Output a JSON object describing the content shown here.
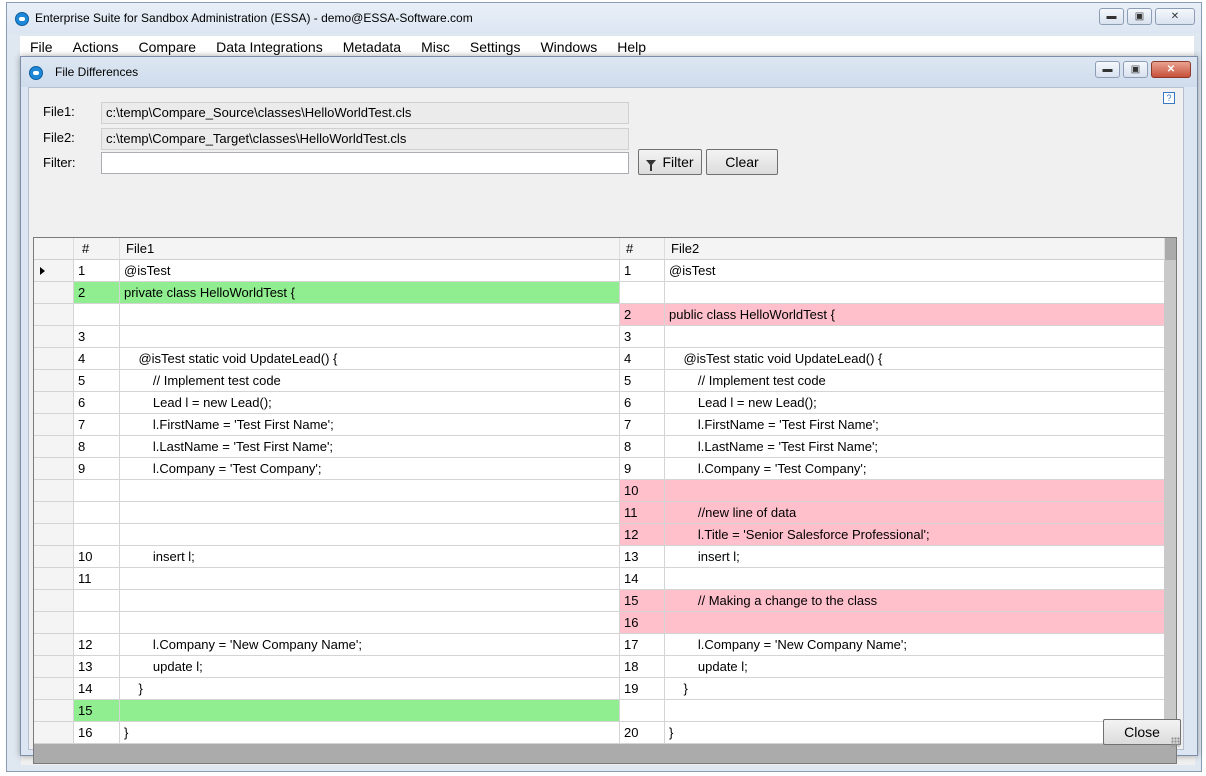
{
  "main_window": {
    "title": "Enterprise Suite for Sandbox Administration (ESSA) - demo@ESSA-Software.com",
    "menu": [
      "File",
      "Actions",
      "Compare",
      "Data Integrations",
      "Metadata",
      "Misc",
      "Settings",
      "Windows",
      "Help"
    ]
  },
  "dialog": {
    "title": "File Differences",
    "help_icon_label": "?",
    "file1_label": "File1:",
    "file1_value": "c:\\temp\\Compare_Source\\classes\\HelloWorldTest.cls",
    "file2_label": "File2:",
    "file2_value": "c:\\temp\\Compare_Target\\classes\\HelloWorldTest.cls",
    "filter_label": "Filter:",
    "filter_value": "",
    "filter_button": "Filter",
    "clear_button": "Clear",
    "close_button": "Close"
  },
  "grid": {
    "headers": {
      "num1": "#",
      "file1": "File1",
      "num2": "#",
      "file2": "File2"
    },
    "rows": [
      {
        "n1": "1",
        "t1": "@isTest",
        "n2": "1",
        "t2": "@isTest",
        "s1": "",
        "s2": "",
        "current": true
      },
      {
        "n1": "2",
        "t1": "private class HelloWorldTest {",
        "n2": "",
        "t2": "",
        "s1": "green",
        "s2": ""
      },
      {
        "n1": "",
        "t1": "",
        "n2": "2",
        "t2": "public class HelloWorldTest {",
        "s1": "",
        "s2": "pink"
      },
      {
        "n1": "3",
        "t1": "",
        "n2": "3",
        "t2": "",
        "s1": "",
        "s2": ""
      },
      {
        "n1": "4",
        "t1": "    @isTest static void UpdateLead() {",
        "n2": "4",
        "t2": "    @isTest static void UpdateLead() {",
        "s1": "",
        "s2": ""
      },
      {
        "n1": "5",
        "t1": "        // Implement test code",
        "n2": "5",
        "t2": "        // Implement test code",
        "s1": "",
        "s2": ""
      },
      {
        "n1": "6",
        "t1": "        Lead l = new Lead();",
        "n2": "6",
        "t2": "        Lead l = new Lead();",
        "s1": "",
        "s2": ""
      },
      {
        "n1": "7",
        "t1": "        l.FirstName = 'Test First Name';",
        "n2": "7",
        "t2": "        l.FirstName = 'Test First Name';",
        "s1": "",
        "s2": ""
      },
      {
        "n1": "8",
        "t1": "        l.LastName = 'Test First Name';",
        "n2": "8",
        "t2": "        l.LastName = 'Test First Name';",
        "s1": "",
        "s2": ""
      },
      {
        "n1": "9",
        "t1": "        l.Company = 'Test Company';",
        "n2": "9",
        "t2": "        l.Company = 'Test Company';",
        "s1": "",
        "s2": ""
      },
      {
        "n1": "",
        "t1": "",
        "n2": "10",
        "t2": "",
        "s1": "",
        "s2": "pink"
      },
      {
        "n1": "",
        "t1": "",
        "n2": "11",
        "t2": "        //new line of data",
        "s1": "",
        "s2": "pink"
      },
      {
        "n1": "",
        "t1": "",
        "n2": "12",
        "t2": "        l.Title = 'Senior Salesforce Professional';",
        "s1": "",
        "s2": "pink"
      },
      {
        "n1": "10",
        "t1": "        insert l;",
        "n2": "13",
        "t2": "        insert l;",
        "s1": "",
        "s2": ""
      },
      {
        "n1": "11",
        "t1": "",
        "n2": "14",
        "t2": "",
        "s1": "",
        "s2": ""
      },
      {
        "n1": "",
        "t1": "",
        "n2": "15",
        "t2": "        // Making a change to the class",
        "s1": "",
        "s2": "pink"
      },
      {
        "n1": "",
        "t1": "",
        "n2": "16",
        "t2": "",
        "s1": "",
        "s2": "pink"
      },
      {
        "n1": "12",
        "t1": "        l.Company = 'New Company Name';",
        "n2": "17",
        "t2": "        l.Company = 'New Company Name';",
        "s1": "",
        "s2": ""
      },
      {
        "n1": "13",
        "t1": "        update l;",
        "n2": "18",
        "t2": "        update l;",
        "s1": "",
        "s2": ""
      },
      {
        "n1": "14",
        "t1": "    }",
        "n2": "19",
        "t2": "    }",
        "s1": "",
        "s2": ""
      },
      {
        "n1": "15",
        "t1": "",
        "n2": "",
        "t2": "",
        "s1": "green",
        "s2": ""
      },
      {
        "n1": "16",
        "t1": "}",
        "n2": "20",
        "t2": "}",
        "s1": "",
        "s2": ""
      }
    ]
  },
  "colors": {
    "added_left": "#90ee90",
    "changed_right": "#ffc0cb"
  }
}
